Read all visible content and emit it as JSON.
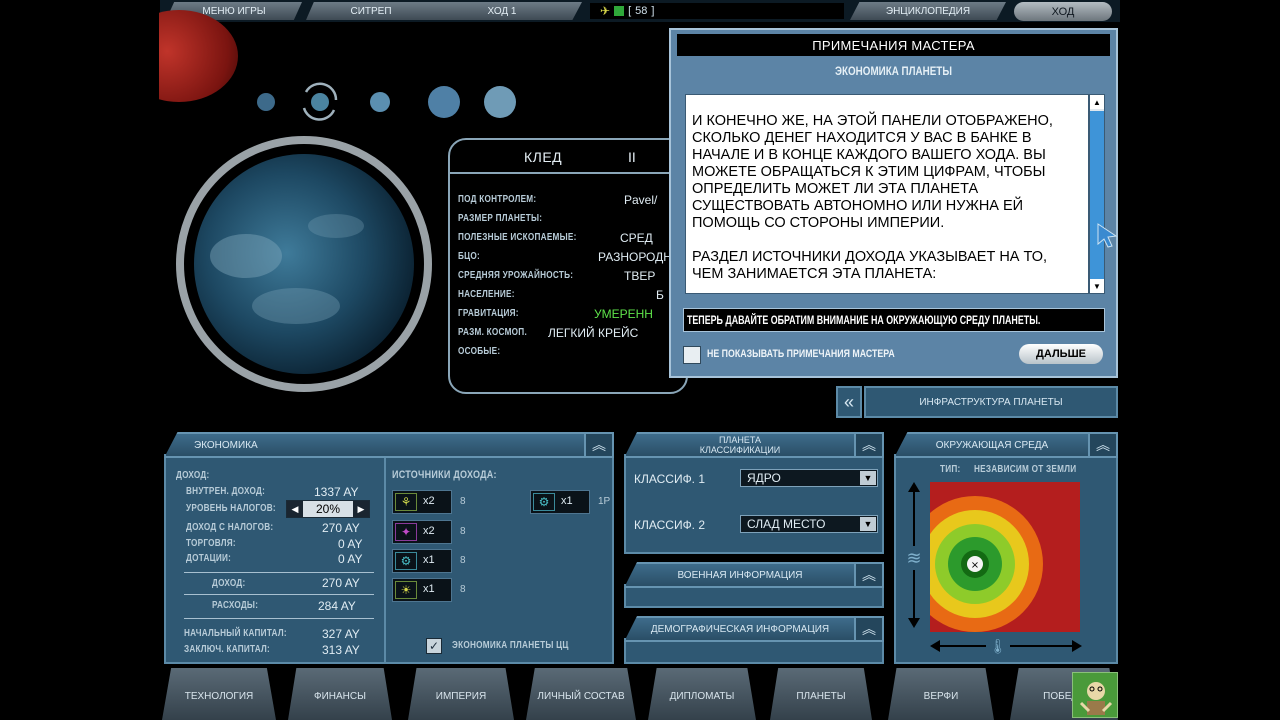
{
  "topbar": {
    "menu": "МЕНЮ ИГРЫ",
    "citrep": "СИТРЕП",
    "turn": "ХОД 1",
    "resource_count": "58",
    "encyclopedia": "ЭНЦИКЛОПЕДИЯ",
    "turn_button": "ХОД"
  },
  "planet": {
    "name": "КЛЕД",
    "index": "II",
    "fields": [
      {
        "label": "ПОД КОНТРОЛЕМ:",
        "value": "Pavel/"
      },
      {
        "label": "РАЗМЕР ПЛАНЕТЫ:",
        "value": ""
      },
      {
        "label": "ПОЛЕЗНЫЕ ИСКОПАЕМЫЕ:",
        "value": "СРЕД"
      },
      {
        "label": "БЦО:",
        "value": "РАЗНОРОДН"
      },
      {
        "label": "СРЕДНЯЯ УРОЖАЙНОСТЬ:",
        "value": "ТВЕР"
      },
      {
        "label": "НАСЕЛЕНИЕ:",
        "value": "Б"
      },
      {
        "label": "ГРАВИТАЦИЯ:",
        "value": "УМЕРЕНН"
      },
      {
        "label": "РАЗМ. КОСМОП.",
        "value": "ЛЕГКИЙ КРЕЙС"
      },
      {
        "label": "ОСОБЫЕ:",
        "value": ""
      }
    ]
  },
  "dialog": {
    "title": "ПРИМЕЧАНИЯ МАСТЕРА",
    "subtitle": "ЭКОНОМИКА ПЛАНЕТЫ",
    "paragraph1": "И конечно же, на этой панели отображено, сколько денег находится у вас в банке в начале и в конце каждого вашего хода. Вы можете обращаться к этим цифрам, чтобы определить может ли эта планета существовать автономно или нужна ей помощь со стороны империи.",
    "paragraph2": "Раздел Источники дохода указывает на то, чем занимается эта планета:",
    "hint": "ТЕПЕРЬ ДАВАЙТЕ ОБРАТИМ ВНИМАНИЕ НА ОКРУЖАЮЩУЮ СРЕДУ ПЛАНЕТЫ.",
    "checkbox_label": "НЕ ПОКАЗЫВАТЬ ПРИМЕЧАНИЯ МАСТЕРА",
    "next_button": "ДАЛЬШЕ"
  },
  "infrastructure": {
    "label": "ИНФРАСТРУКТУРА ПЛАНЕТЫ"
  },
  "economy": {
    "title": "ЭКОНОМИКА",
    "income_label": "ДОХОД:",
    "rows": [
      {
        "label": "ВНУТРЕН. ДОХОД:",
        "value": "1337 AY"
      },
      {
        "label": "УРОВЕНЬ НАЛОГОВ:",
        "value": "20%"
      },
      {
        "label": "ДОХОД С НАЛОГОВ:",
        "value": "270 AY"
      },
      {
        "label": "ТОРГОВЛЯ:",
        "value": "0 AY"
      },
      {
        "label": "ДОТАЦИИ:",
        "value": "0 AY"
      }
    ],
    "total_income_label": "ДОХОД:",
    "total_income_value": "270 AY",
    "expenses_label": "РАСХОДЫ:",
    "expenses_value": "284 AY",
    "start_capital_label": "НАЧАЛЬНЫЙ КАПИТАЛ:",
    "start_capital_value": "327 AY",
    "end_capital_label": "ЗАКЛЮЧ. КАПИТАЛ:",
    "end_capital_value": "313 AY",
    "sources_title": "ИСТОЧНИКИ ДОХОДА:",
    "sources": [
      {
        "icon": "wheat-icon",
        "count": "x2",
        "b": "8"
      },
      {
        "icon": "crystal-icon",
        "count": "x2",
        "b": "8"
      },
      {
        "icon": "factory-icon",
        "count": "x1",
        "b": "8"
      },
      {
        "icon": "lightbulb-icon",
        "count": "x1",
        "b": "8"
      }
    ],
    "source_right": {
      "icon": "gear-icon",
      "count": "x1",
      "b": "1P"
    },
    "economy_check_label": "ЭКОНОМИКА ПЛАНЕТЫ ЦЦ"
  },
  "classification": {
    "title_line1": "ПЛАНЕТА",
    "title_line2": "КЛАССИФИКАЦИИ",
    "class1_label": "КЛАССИФ. 1",
    "class1_value": "ЯДРО",
    "class2_label": "КЛАССИФ. 2",
    "class2_value": "СЛАД МЕСТО"
  },
  "military": {
    "title": "ВОЕННАЯ ИНФОРМАЦИЯ"
  },
  "demographic": {
    "title": "ДЕМОГРАФИЧЕСКАЯ ИНФОРМАЦИЯ"
  },
  "environment": {
    "title": "ОКРУЖАЮЩАЯ СРЕДА",
    "type_label": "ТИП:",
    "type_value": "НЕЗАВИСИМ ОТ ЗЕМЛИ"
  },
  "bottom_tabs": [
    "ТЕХНОЛОГИЯ",
    "ФИНАНСЫ",
    "ИМПЕРИЯ",
    "ЛИЧНЫЙ СОСТАВ",
    "ДИПЛОМАТЫ",
    "ПЛАНЕТЫ",
    "ВЕРФИ",
    "ПОБЕДА"
  ],
  "colors": {
    "panel": "#2f5873",
    "border": "#5c8aa7",
    "gravity_green": "#5ee24a",
    "ring_red": "#b41e1e",
    "ring_orange": "#e86a14",
    "ring_yellow": "#e8c81c",
    "ring_lightgreen": "#8ecb2a",
    "ring_green": "#2c9a2c"
  }
}
